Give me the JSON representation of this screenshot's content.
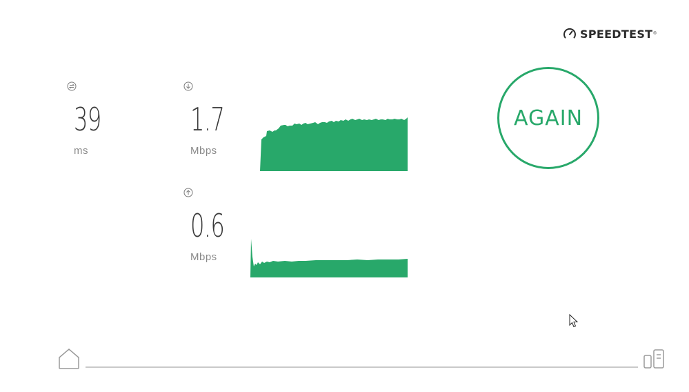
{
  "brand": {
    "name": "SPEEDTEST",
    "trademark": "®",
    "icon": "speedometer-icon"
  },
  "ping": {
    "icon": "ping-icon",
    "value": "39",
    "unit": "ms"
  },
  "download": {
    "icon": "download-arrow-icon",
    "value": "1.7",
    "unit": "Mbps"
  },
  "upload": {
    "icon": "upload-arrow-icon",
    "value": "0.6",
    "unit": "Mbps"
  },
  "action": {
    "label": "AGAIN"
  },
  "footer": {
    "left_icon": "home-icon",
    "right_icon": "server-icon"
  },
  "colors": {
    "accent": "#28a86a",
    "text": "#3a3a3a",
    "muted": "#8a8a8a",
    "line": "#c9c9c9"
  }
}
